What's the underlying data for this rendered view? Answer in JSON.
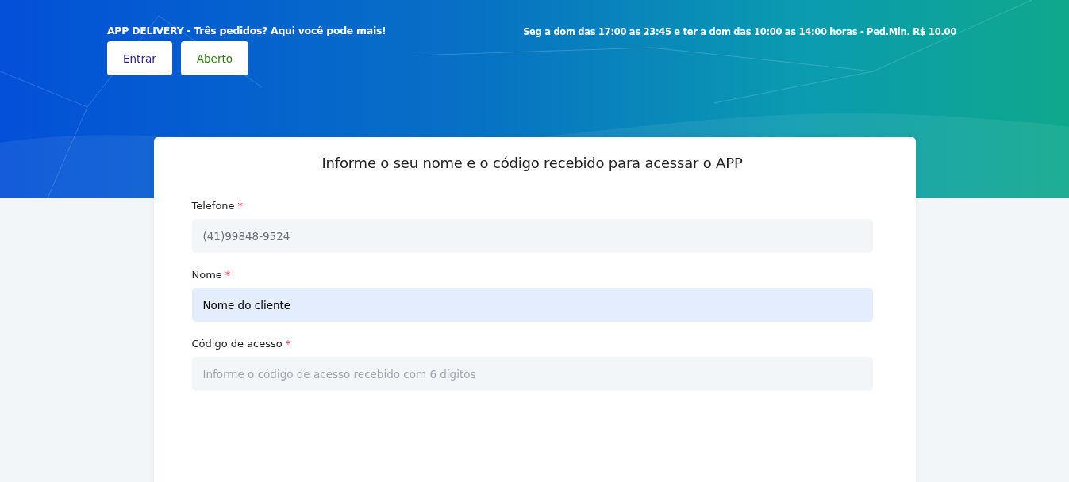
{
  "header": {
    "tagline": "APP DELIVERY - Três pedidos? Aqui você pode mais!",
    "hours": "Seg a dom das 17:00 as 23:45 e ter a dom das 10:00 as 14:00 horas - Ped.Min. R$ 10.00",
    "buttons": [
      {
        "label": "Entrar",
        "kind": "login"
      },
      {
        "label": "Aberto",
        "kind": "status"
      }
    ]
  },
  "form": {
    "title": "Informe o seu nome e o código recebido para acessar o APP",
    "fields": [
      {
        "label": "Telefone",
        "required_mark": "*",
        "value": "(41)99848-9524",
        "disabled": true,
        "autofilled": false
      },
      {
        "label": "Nome",
        "required_mark": "*",
        "value": "Nome do cliente",
        "disabled": false,
        "autofilled": true
      },
      {
        "label": "Código de acesso",
        "required_mark": "*",
        "placeholder": "Informe o código de acesso recebido com 6 dígitos",
        "disabled": false,
        "autofilled": false
      }
    ]
  }
}
